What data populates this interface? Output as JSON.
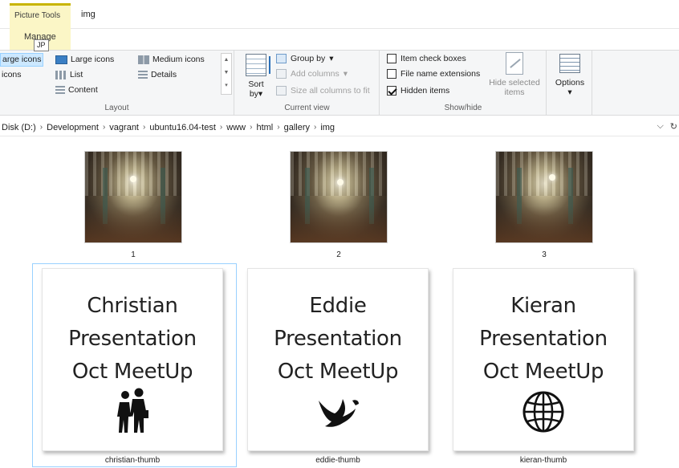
{
  "titlebar": {
    "context_tab": "Picture Tools",
    "window_title": "img",
    "manage_tab": "Manage",
    "tooltip": "JP"
  },
  "ribbon": {
    "layout": {
      "items": {
        "extra_large": "arge icons",
        "large": "Large icons",
        "medium": "Medium icons",
        "small": "icons",
        "list": "List",
        "details": "Details",
        "content": "Content"
      },
      "label": "Layout"
    },
    "current_view": {
      "sort_label_1": "Sort",
      "sort_label_2": "by",
      "group_by": "Group by",
      "add_columns": "Add columns",
      "size_columns": "Size all columns to fit",
      "label": "Current view"
    },
    "show_hide": {
      "item_check_boxes": "Item check boxes",
      "file_name_extensions": "File name extensions",
      "hidden_items": "Hidden items",
      "hide_selected_1": "Hide selected",
      "hide_selected_2": "items",
      "label": "Show/hide"
    },
    "options": {
      "label": "Options"
    }
  },
  "address": {
    "crumbs": [
      "Disk (D:)",
      "Development",
      "vagrant",
      "ubuntu16.04-test",
      "www",
      "html",
      "gallery",
      "img"
    ]
  },
  "files": {
    "photos": [
      {
        "name": "1"
      },
      {
        "name": "2"
      },
      {
        "name": "3"
      }
    ],
    "thumbs": [
      {
        "name": "christian-thumb",
        "line1": "Christian",
        "line2": "Presentation",
        "line3": "Oct MeetUp",
        "icon": "people-walking-icon"
      },
      {
        "name": "eddie-thumb",
        "line1": "Eddie",
        "line2": "Presentation",
        "line3": "Oct MeetUp",
        "icon": "bird-icon"
      },
      {
        "name": "kieran-thumb",
        "line1": "Kieran",
        "line2": "Presentation",
        "line3": "Oct MeetUp",
        "icon": "globe-icon"
      }
    ]
  },
  "colors": {
    "selection_fill": "#cce8ff",
    "selection_border": "#99d1ff",
    "context_tab": "#fbf6c6"
  }
}
